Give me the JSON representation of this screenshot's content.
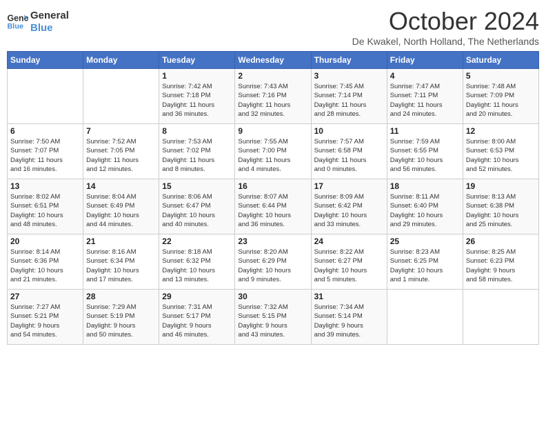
{
  "header": {
    "logo_line1": "General",
    "logo_line2": "Blue",
    "month_title": "October 2024",
    "location": "De Kwakel, North Holland, The Netherlands"
  },
  "weekdays": [
    "Sunday",
    "Monday",
    "Tuesday",
    "Wednesday",
    "Thursday",
    "Friday",
    "Saturday"
  ],
  "weeks": [
    [
      {
        "day": "",
        "info": ""
      },
      {
        "day": "",
        "info": ""
      },
      {
        "day": "1",
        "info": "Sunrise: 7:42 AM\nSunset: 7:18 PM\nDaylight: 11 hours\nand 36 minutes."
      },
      {
        "day": "2",
        "info": "Sunrise: 7:43 AM\nSunset: 7:16 PM\nDaylight: 11 hours\nand 32 minutes."
      },
      {
        "day": "3",
        "info": "Sunrise: 7:45 AM\nSunset: 7:14 PM\nDaylight: 11 hours\nand 28 minutes."
      },
      {
        "day": "4",
        "info": "Sunrise: 7:47 AM\nSunset: 7:11 PM\nDaylight: 11 hours\nand 24 minutes."
      },
      {
        "day": "5",
        "info": "Sunrise: 7:48 AM\nSunset: 7:09 PM\nDaylight: 11 hours\nand 20 minutes."
      }
    ],
    [
      {
        "day": "6",
        "info": "Sunrise: 7:50 AM\nSunset: 7:07 PM\nDaylight: 11 hours\nand 16 minutes."
      },
      {
        "day": "7",
        "info": "Sunrise: 7:52 AM\nSunset: 7:05 PM\nDaylight: 11 hours\nand 12 minutes."
      },
      {
        "day": "8",
        "info": "Sunrise: 7:53 AM\nSunset: 7:02 PM\nDaylight: 11 hours\nand 8 minutes."
      },
      {
        "day": "9",
        "info": "Sunrise: 7:55 AM\nSunset: 7:00 PM\nDaylight: 11 hours\nand 4 minutes."
      },
      {
        "day": "10",
        "info": "Sunrise: 7:57 AM\nSunset: 6:58 PM\nDaylight: 11 hours\nand 0 minutes."
      },
      {
        "day": "11",
        "info": "Sunrise: 7:59 AM\nSunset: 6:55 PM\nDaylight: 10 hours\nand 56 minutes."
      },
      {
        "day": "12",
        "info": "Sunrise: 8:00 AM\nSunset: 6:53 PM\nDaylight: 10 hours\nand 52 minutes."
      }
    ],
    [
      {
        "day": "13",
        "info": "Sunrise: 8:02 AM\nSunset: 6:51 PM\nDaylight: 10 hours\nand 48 minutes."
      },
      {
        "day": "14",
        "info": "Sunrise: 8:04 AM\nSunset: 6:49 PM\nDaylight: 10 hours\nand 44 minutes."
      },
      {
        "day": "15",
        "info": "Sunrise: 8:06 AM\nSunset: 6:47 PM\nDaylight: 10 hours\nand 40 minutes."
      },
      {
        "day": "16",
        "info": "Sunrise: 8:07 AM\nSunset: 6:44 PM\nDaylight: 10 hours\nand 36 minutes."
      },
      {
        "day": "17",
        "info": "Sunrise: 8:09 AM\nSunset: 6:42 PM\nDaylight: 10 hours\nand 33 minutes."
      },
      {
        "day": "18",
        "info": "Sunrise: 8:11 AM\nSunset: 6:40 PM\nDaylight: 10 hours\nand 29 minutes."
      },
      {
        "day": "19",
        "info": "Sunrise: 8:13 AM\nSunset: 6:38 PM\nDaylight: 10 hours\nand 25 minutes."
      }
    ],
    [
      {
        "day": "20",
        "info": "Sunrise: 8:14 AM\nSunset: 6:36 PM\nDaylight: 10 hours\nand 21 minutes."
      },
      {
        "day": "21",
        "info": "Sunrise: 8:16 AM\nSunset: 6:34 PM\nDaylight: 10 hours\nand 17 minutes."
      },
      {
        "day": "22",
        "info": "Sunrise: 8:18 AM\nSunset: 6:32 PM\nDaylight: 10 hours\nand 13 minutes."
      },
      {
        "day": "23",
        "info": "Sunrise: 8:20 AM\nSunset: 6:29 PM\nDaylight: 10 hours\nand 9 minutes."
      },
      {
        "day": "24",
        "info": "Sunrise: 8:22 AM\nSunset: 6:27 PM\nDaylight: 10 hours\nand 5 minutes."
      },
      {
        "day": "25",
        "info": "Sunrise: 8:23 AM\nSunset: 6:25 PM\nDaylight: 10 hours\nand 1 minute."
      },
      {
        "day": "26",
        "info": "Sunrise: 8:25 AM\nSunset: 6:23 PM\nDaylight: 9 hours\nand 58 minutes."
      }
    ],
    [
      {
        "day": "27",
        "info": "Sunrise: 7:27 AM\nSunset: 5:21 PM\nDaylight: 9 hours\nand 54 minutes."
      },
      {
        "day": "28",
        "info": "Sunrise: 7:29 AM\nSunset: 5:19 PM\nDaylight: 9 hours\nand 50 minutes."
      },
      {
        "day": "29",
        "info": "Sunrise: 7:31 AM\nSunset: 5:17 PM\nDaylight: 9 hours\nand 46 minutes."
      },
      {
        "day": "30",
        "info": "Sunrise: 7:32 AM\nSunset: 5:15 PM\nDaylight: 9 hours\nand 43 minutes."
      },
      {
        "day": "31",
        "info": "Sunrise: 7:34 AM\nSunset: 5:14 PM\nDaylight: 9 hours\nand 39 minutes."
      },
      {
        "day": "",
        "info": ""
      },
      {
        "day": "",
        "info": ""
      }
    ]
  ]
}
